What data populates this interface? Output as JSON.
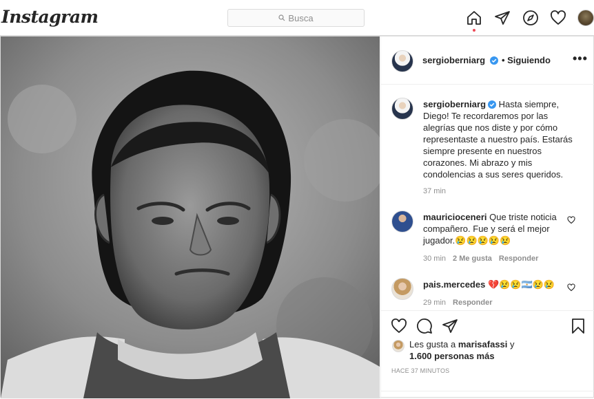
{
  "topbar": {
    "logo": "Instagram",
    "search_placeholder": "Busca"
  },
  "post": {
    "author": "sergioberniarg",
    "follow_status": "• Siguiendo",
    "caption": {
      "username": "sergioberniarg",
      "text": "Hasta siempre, Diego! Te recordaremos por las alegrías que nos diste y por cómo representaste a nuestro país. Estarás siempre presente en nuestros corazones. Mi abrazo y mis condolencias a sus seres queridos.",
      "time": "37 min"
    },
    "comments": [
      {
        "username": "mauricioceneri",
        "text": "Que triste noticia compañero. Fue y será el mejor jugador.😢😢😢😢😢",
        "time": "30 min",
        "likes": "2 Me gusta",
        "reply": "Responder"
      },
      {
        "username": "pais.mercedes",
        "text": "💔😢😢🇦🇷😢😢",
        "time": "29 min",
        "reply": "Responder"
      }
    ],
    "likes_line1_prefix": "Les gusta a",
    "likes_user": "marisafassi",
    "likes_line1_suffix": "y",
    "likes_line2": "1.600 personas más",
    "timestamp": "HACE 37 MINUTOS"
  },
  "colors": {
    "verified": "#3897f0",
    "notification_dot": "#ed4956",
    "border": "#dbdbdb",
    "muted_text": "#8e8e8e"
  },
  "icons": [
    "search-icon",
    "home-icon",
    "direct-icon",
    "explore-icon",
    "heart-icon",
    "verified-icon",
    "more-icon",
    "comment-icon",
    "share-icon",
    "save-icon"
  ]
}
